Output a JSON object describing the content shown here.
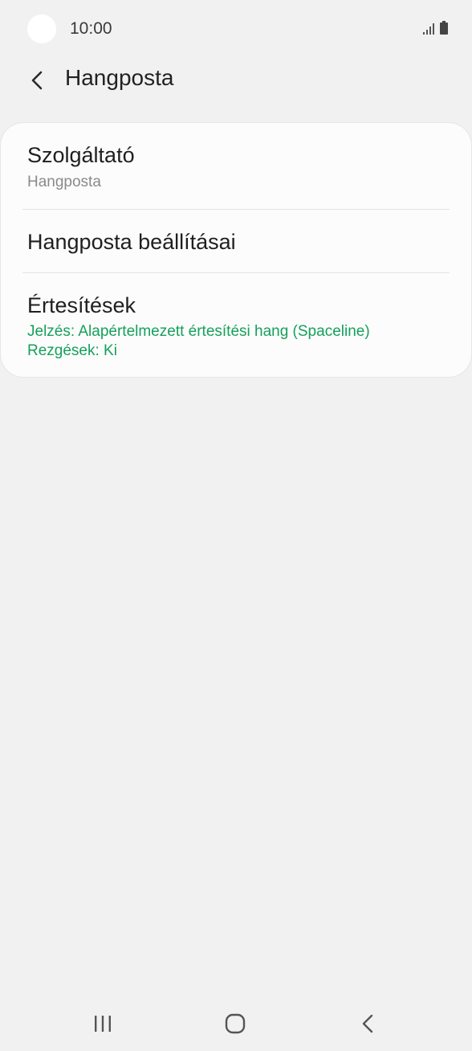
{
  "status_bar": {
    "time": "10:00"
  },
  "header": {
    "title": "Hangposta",
    "back_icon": "chevron-left-icon"
  },
  "settings": {
    "items": [
      {
        "title": "Szolgáltató",
        "subtitle": "Hangposta"
      },
      {
        "title": "Hangposta beállításai"
      },
      {
        "title": "Értesítések",
        "subtitle_lines": [
          "Jelzés: Alapértelmezett értesítési hang (Spaceline)",
          "Rezgések: Ki"
        ]
      }
    ]
  },
  "nav_bar": {
    "recents_icon": "recents-icon",
    "home_icon": "home-icon",
    "back_icon": "back-icon"
  },
  "colors": {
    "background": "#f1f1f1",
    "card": "#fcfcfc",
    "accent_green": "#16a05b",
    "subtitle_gray": "#8a8a8a"
  }
}
